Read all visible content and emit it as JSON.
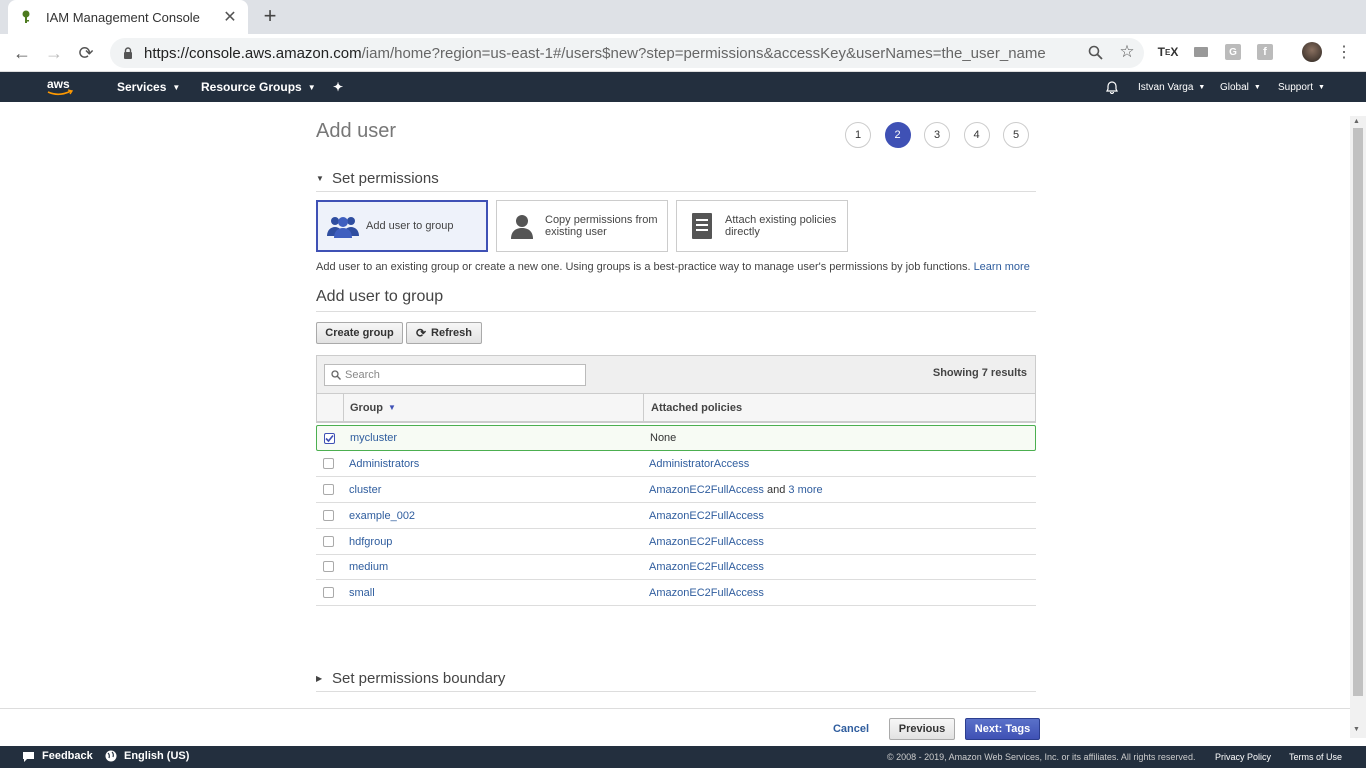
{
  "browser": {
    "tab_title": "IAM Management Console",
    "url_domain": "https://console.aws.amazon.com",
    "url_path": "/iam/home?region=us-east-1#/users$new?step=permissions&accessKey&userNames=the_user_name"
  },
  "aws_nav": {
    "services": "Services",
    "resource_groups": "Resource Groups",
    "user": "Istvan Varga",
    "region": "Global",
    "support": "Support"
  },
  "page": {
    "title": "Add user",
    "steps": [
      "1",
      "2",
      "3",
      "4",
      "5"
    ],
    "active_step": 2,
    "set_permissions": "Set permissions",
    "options": [
      {
        "label": "Add user to group",
        "selected": true
      },
      {
        "label": "Copy permissions from existing user",
        "selected": false
      },
      {
        "label": "Attach existing policies directly",
        "selected": false
      }
    ],
    "description": "Add user to an existing group or create a new one. Using groups is a best-practice way to manage user's permissions by job functions.",
    "learn_more": "Learn more",
    "group_heading": "Add user to group",
    "create_group": "Create group",
    "refresh": "Refresh",
    "search_placeholder": "Search",
    "showing": "Showing 7 results",
    "col_group": "Group",
    "col_policies": "Attached policies",
    "rows": [
      {
        "group": "mycluster",
        "policy": "None",
        "checked": true
      },
      {
        "group": "Administrators",
        "policy": "AdministratorAccess",
        "checked": false
      },
      {
        "group": "cluster",
        "policy": "AmazonEC2FullAccess",
        "policy_and": "and",
        "policy_more": "3 more",
        "checked": false
      },
      {
        "group": "example_002",
        "policy": "AmazonEC2FullAccess",
        "checked": false
      },
      {
        "group": "hdfgroup",
        "policy": "AmazonEC2FullAccess",
        "checked": false
      },
      {
        "group": "medium",
        "policy": "AmazonEC2FullAccess",
        "checked": false
      },
      {
        "group": "small",
        "policy": "AmazonEC2FullAccess",
        "checked": false
      }
    ],
    "boundary": "Set permissions boundary"
  },
  "actions": {
    "cancel": "Cancel",
    "previous": "Previous",
    "next": "Next: Tags"
  },
  "footer": {
    "feedback": "Feedback",
    "language": "English (US)",
    "copyright": "© 2008 - 2019, Amazon Web Services, Inc. or its affiliates. All rights reserved.",
    "privacy": "Privacy Policy",
    "terms": "Terms of Use"
  },
  "colors": {
    "accent": "#3f51b5",
    "aws_dark": "#232f3e",
    "link": "#2f5d9e"
  }
}
